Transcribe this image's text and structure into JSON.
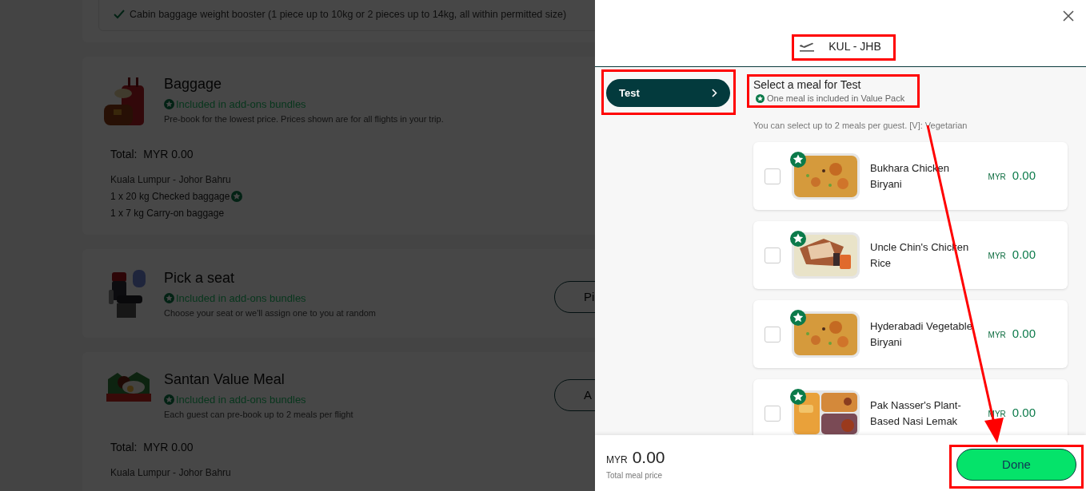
{
  "background": {
    "booster_item": "Cabin baggage weight booster (1 piece up to 10kg or 2 pieces up to 14kg, all within permitted size)",
    "sections": [
      {
        "kind": "baggage",
        "title": "Baggage",
        "badge": "Included in add-ons bundles",
        "description": "Pre-book for the lowest price. Prices shown are for all flights in your trip.",
        "total": "Total:  MYR 0.00",
        "route": "Kuala Lumpur - Johor Bahru",
        "items": [
          {
            "text": "1 x 20 kg Checked baggage",
            "included": true
          },
          {
            "text": "1 x 7 kg Carry-on baggage",
            "included": false
          }
        ]
      },
      {
        "kind": "seat",
        "title": "Pick a seat",
        "badge": "Included in add-ons bundles",
        "description": "Choose your seat or we'll assign one to you at random",
        "button": "Pi"
      },
      {
        "kind": "meal",
        "title": "Santan Value Meal",
        "badge": "Included in add-ons bundles",
        "description": "Each guest can pre-book up to 2 meals per flight",
        "button": "A",
        "total": "Total:  MYR 0.00",
        "route": "Kuala Lumpur - Johor Bahru"
      }
    ]
  },
  "drawer": {
    "route": "KUL - JHB",
    "passengers": [
      {
        "name": "Test",
        "selected": true
      }
    ],
    "heading": "Select a meal for Test",
    "included_note": "One meal is included in Value Pack",
    "hint": "You can select up to 2 meals per guest. [V]: Vegetarian",
    "meals": [
      {
        "name": "Bukhara Chicken Biryani",
        "currency": "MYR",
        "price": "0.00",
        "checked": false,
        "included": true,
        "kind": "biryani"
      },
      {
        "name": "Uncle Chin's Chicken Rice",
        "currency": "MYR",
        "price": "0.00",
        "checked": false,
        "included": true,
        "kind": "chicken-rice"
      },
      {
        "name": "Hyderabadi Vegetable Biryani",
        "currency": "MYR",
        "price": "0.00",
        "checked": false,
        "included": true,
        "kind": "biryani"
      },
      {
        "name": "Pak Nasser's Plant-Based Nasi Lemak",
        "currency": "MYR",
        "price": "0.00",
        "checked": false,
        "included": true,
        "kind": "nasi-lemak"
      }
    ],
    "footer": {
      "currency": "MYR",
      "total": "0.00",
      "label": "Total meal price"
    },
    "done_button": "Done"
  }
}
